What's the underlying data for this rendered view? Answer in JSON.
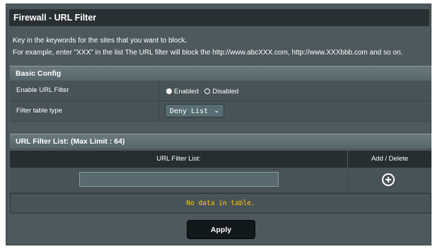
{
  "page": {
    "title": "Firewall - URL Filter",
    "desc_line1": "Key in the keywords for the sites that you want to block.",
    "desc_line2": "For example, enter \"XXX\" in the list The URL filter will block the http://www.abcXXX.com, http://www.XXXbbb.com and so on."
  },
  "basic_config": {
    "header": "Basic Config",
    "enable_label": "Enable URL Filter",
    "enabled_option": "Enabled",
    "disabled_option": "Disabled",
    "selected_option": "Enabled",
    "filter_type_label": "Filter table type",
    "filter_type_value": "Deny List"
  },
  "url_list": {
    "header": "URL Filter List: (Max Limit : 64)",
    "col_url": "URL Filter List:",
    "col_action": "Add / Delete",
    "input_value": "",
    "empty_message": "No data in table."
  },
  "actions": {
    "apply_label": "Apply"
  },
  "icons": {
    "add": "plus-circle-icon",
    "dropdown": "chevron-down-icon"
  },
  "colors": {
    "panel_bg": "#4d595d",
    "title_bg": "#283034",
    "empty_text": "#ffcc00"
  }
}
